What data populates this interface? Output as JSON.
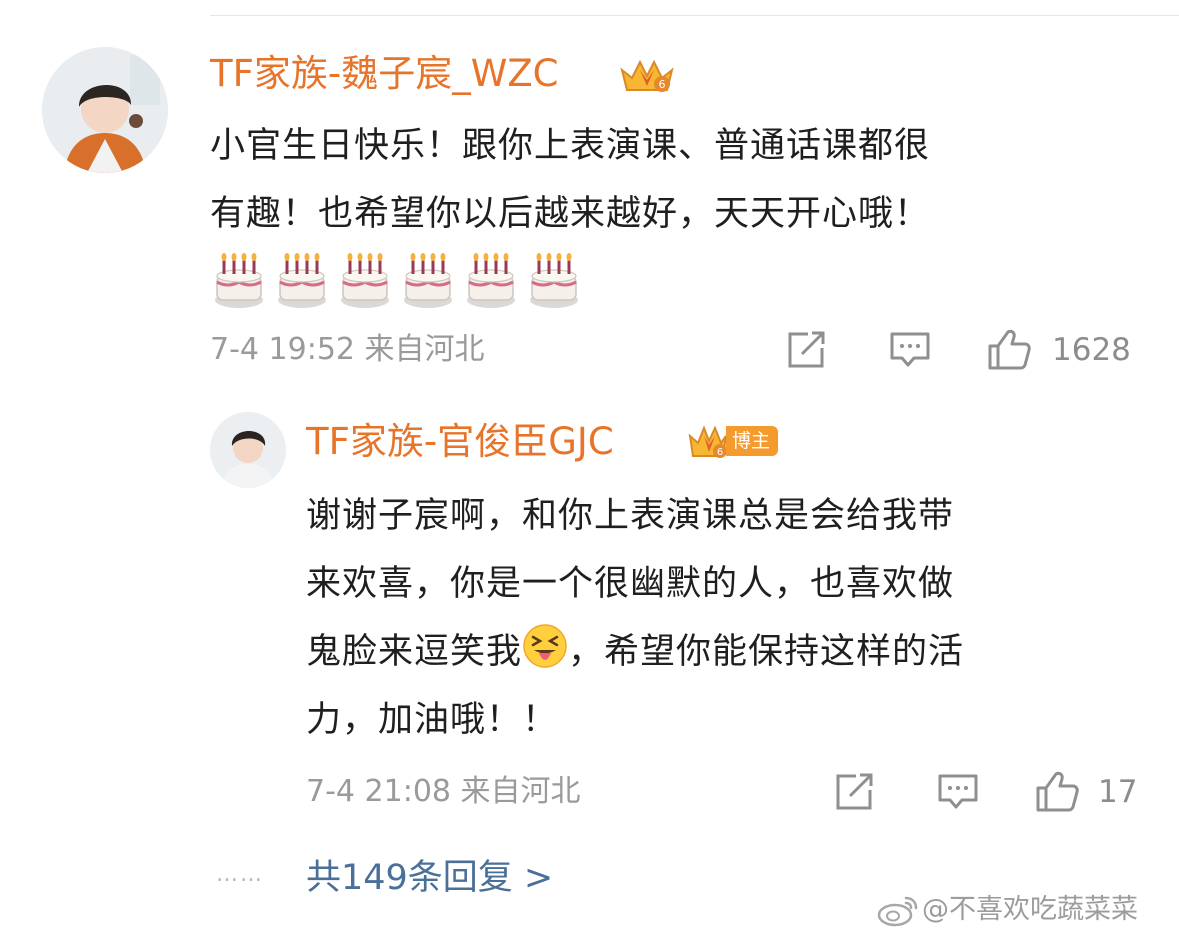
{
  "comment": {
    "username": "TF家族-魏子宸_WZC",
    "text_line1": "小官生日快乐！跟你上表演课、普通话课都很",
    "text_line2": "有趣！也希望你以后越来越好，天天开心哦！",
    "emoji_row": "🎂🎂🎂🎂🎂🎂",
    "timestamp": "7-4 19:52",
    "location": "来自河北",
    "like_count": "1628",
    "crown_level": "6"
  },
  "reply": {
    "username": "TF家族-官俊臣GJC",
    "blogger_badge": "博主",
    "crown_level": "6",
    "text_line1": "谢谢子宸啊，和你上表演课总是会给我带",
    "text_line2": "来欢喜，你是一个很幽默的人，也喜欢做",
    "text_line3a": "鬼脸来逗笑我",
    "text_line3b": "，希望你能保持这样的活",
    "text_line4": "力，加油哦！！",
    "timestamp": "7-4 21:08",
    "location": "来自河北",
    "like_count": "17"
  },
  "more_replies": {
    "dots": "……",
    "label": "共149条回复 >"
  },
  "watermark": {
    "text": "@不喜欢吃蔬菜菜"
  },
  "icons": {
    "share": "share-icon",
    "comment": "comment-icon",
    "like": "thumbs-up-icon",
    "crown": "crown-badge-icon",
    "emoji_tongue": "squinting-tongue-emoji",
    "cake": "birthday-cake-emoji",
    "weibo": "weibo-logo-icon"
  },
  "colors": {
    "username": "#e8742a",
    "link": "#4a6f99",
    "meta": "#9a9a9a",
    "badge": "#f59a2c"
  }
}
